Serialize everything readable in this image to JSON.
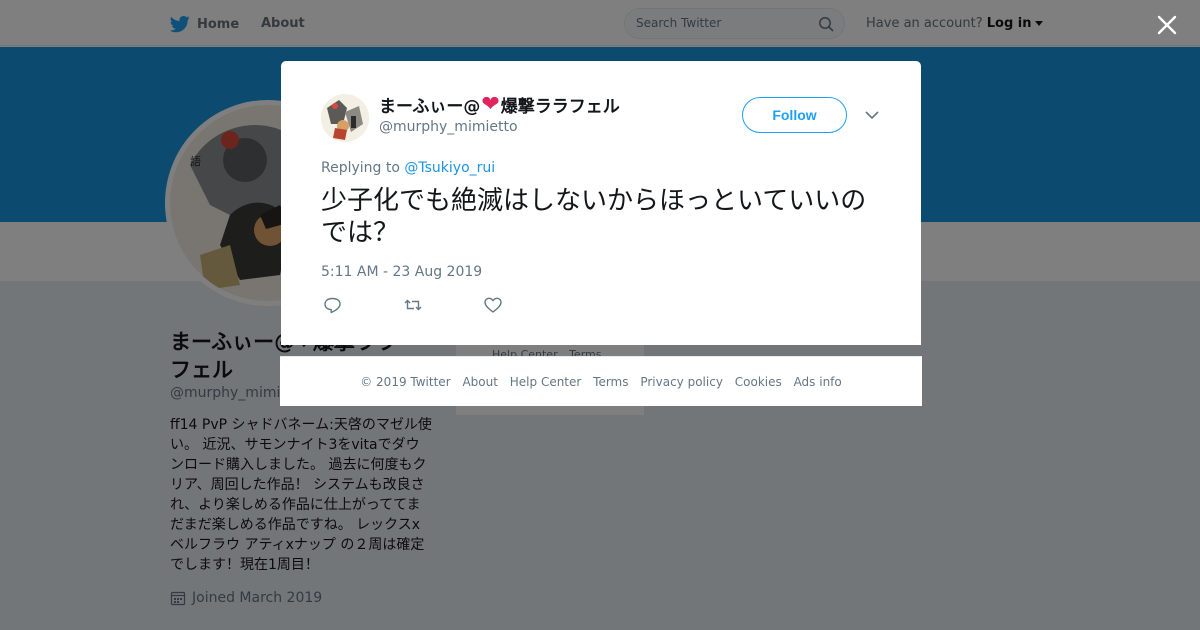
{
  "nav": {
    "home_label": "Home",
    "about_label": "About",
    "search_placeholder": "Search Twitter",
    "have_account_text": "Have an account?",
    "login_label": "Log in"
  },
  "profile": {
    "name_line1": "まーふぃー@❤爆撃ララ",
    "name_line2": "フェル",
    "handle": "@murphy_mimietto",
    "bio": "ff14 PvP シャドバネーム:天啓のマゼル使い。 近況、サモンナイト3をvitaでダウンロード購入しました。 過去に何度もクリア、周回した作品！ システムも改良され、より楽しめる作品に仕上がっててまだまだ楽しめる作品ですね。 レックスxベルフラウ アティxナップ の２周は確定でします！現在1周目！",
    "joined": "Joined March 2019"
  },
  "side_links": [
    "Help Center",
    "Terms"
  ],
  "tweet": {
    "name_prefix": "まーふぃー@",
    "name_heart": "❤",
    "name_suffix": "爆撃ララフェル",
    "handle": "@murphy_mimietto",
    "follow_label": "Follow",
    "replying_prefix": "Replying to",
    "replying_to": "@Tsukiyo_rui",
    "text": "少子化でも絶滅はしないからほっといていいのでは？",
    "timestamp": "5:11 AM - 23 Aug 2019"
  },
  "footer": {
    "links": [
      "© 2019 Twitter",
      "About",
      "Help Center",
      "Terms",
      "Privacy policy",
      "Cookies",
      "Ads info"
    ]
  },
  "colors": {
    "accent": "#1da1f2",
    "banner": "#1b95e0",
    "heart": "#e0245e"
  },
  "icons": [
    "twitter-bird-icon",
    "search-icon",
    "close-icon",
    "chevron-down-icon",
    "reply-icon",
    "retweet-icon",
    "like-icon",
    "calendar-icon"
  ]
}
